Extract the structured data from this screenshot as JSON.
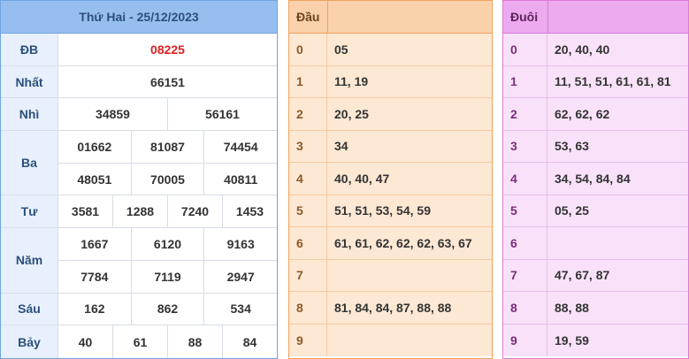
{
  "results": {
    "title": "Thứ Hai - 25/12/2023",
    "rows": [
      {
        "label": "ĐB",
        "lines": [
          [
            "08225"
          ]
        ],
        "highlight": true
      },
      {
        "label": "Nhất",
        "lines": [
          [
            "66151"
          ]
        ]
      },
      {
        "label": "Nhì",
        "lines": [
          [
            "34859",
            "56161"
          ]
        ]
      },
      {
        "label": "Ba",
        "lines": [
          [
            "01662",
            "81087",
            "74454"
          ],
          [
            "48051",
            "70005",
            "40811"
          ]
        ]
      },
      {
        "label": "Tư",
        "lines": [
          [
            "3581",
            "1288",
            "7240",
            "1453"
          ]
        ]
      },
      {
        "label": "Năm",
        "lines": [
          [
            "1667",
            "6120",
            "9163"
          ],
          [
            "7784",
            "7119",
            "2947"
          ]
        ]
      },
      {
        "label": "Sáu",
        "lines": [
          [
            "162",
            "862",
            "534"
          ]
        ]
      },
      {
        "label": "Bảy",
        "lines": [
          [
            "40",
            "61",
            "88",
            "84"
          ]
        ]
      }
    ]
  },
  "dau": {
    "title": "Đầu",
    "rows": [
      {
        "key": "0",
        "values": "05"
      },
      {
        "key": "1",
        "values": "11, 19"
      },
      {
        "key": "2",
        "values": "20, 25"
      },
      {
        "key": "3",
        "values": "34"
      },
      {
        "key": "4",
        "values": "40, 40, 47"
      },
      {
        "key": "5",
        "values": "51, 51, 53, 54, 59"
      },
      {
        "key": "6",
        "values": "61, 61, 62, 62, 62, 63, 67"
      },
      {
        "key": "7",
        "values": ""
      },
      {
        "key": "8",
        "values": "81, 84, 84, 87, 88, 88"
      },
      {
        "key": "9",
        "values": ""
      }
    ]
  },
  "duoi": {
    "title": "Đuôi",
    "rows": [
      {
        "key": "0",
        "values": "20, 40, 40"
      },
      {
        "key": "1",
        "values": "11, 51, 51, 61, 61, 81"
      },
      {
        "key": "2",
        "values": "62, 62, 62"
      },
      {
        "key": "3",
        "values": "53, 63"
      },
      {
        "key": "4",
        "values": "34, 54, 84, 84"
      },
      {
        "key": "5",
        "values": "05, 25"
      },
      {
        "key": "6",
        "values": ""
      },
      {
        "key": "7",
        "values": "47, 67, 87"
      },
      {
        "key": "8",
        "values": "88, 88"
      },
      {
        "key": "9",
        "values": "19, 59"
      }
    ]
  }
}
